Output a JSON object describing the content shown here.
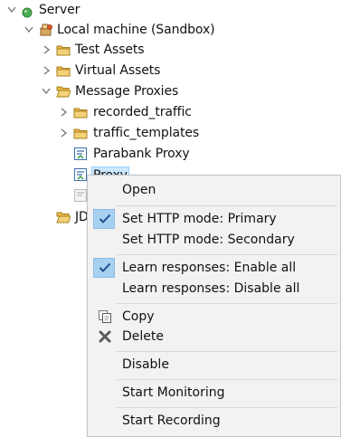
{
  "tree": {
    "items": [
      {
        "label": "Server",
        "icon": "server-status-icon"
      },
      {
        "label": "Local machine (Sandbox)",
        "icon": "local-machine-icon"
      },
      {
        "label": "Test Assets",
        "icon": "folder-icon"
      },
      {
        "label": "Virtual Assets",
        "icon": "folder-icon"
      },
      {
        "label": "Message Proxies",
        "icon": "folder-open-icon"
      },
      {
        "label": "recorded_traffic",
        "icon": "folder-icon"
      },
      {
        "label": "traffic_templates",
        "icon": "folder-icon"
      },
      {
        "label": "Parabank Proxy",
        "icon": "proxy-icon"
      },
      {
        "label": "Proxy",
        "icon": "proxy-icon"
      },
      {
        "label": "",
        "icon": "proxy-disabled-icon"
      },
      {
        "label": "JD",
        "icon": "folder-open-icon"
      }
    ]
  },
  "context_menu": {
    "items": {
      "open": "Open",
      "http_primary": "Set HTTP mode: Primary",
      "http_secondary": "Set HTTP mode: Secondary",
      "learn_enable": "Learn responses: Enable all",
      "learn_disable": "Learn responses: Disable all",
      "copy": "Copy",
      "delete": "Delete",
      "disable": "Disable",
      "start_monitoring": "Start Monitoring",
      "start_recording": "Start Recording"
    }
  },
  "colors": {
    "server_status": "#4caf50",
    "selection": "#cce8ff",
    "menu_background": "#f2f2f2",
    "check_highlight": "#a8d0f0",
    "folder": "#e8b84a"
  }
}
